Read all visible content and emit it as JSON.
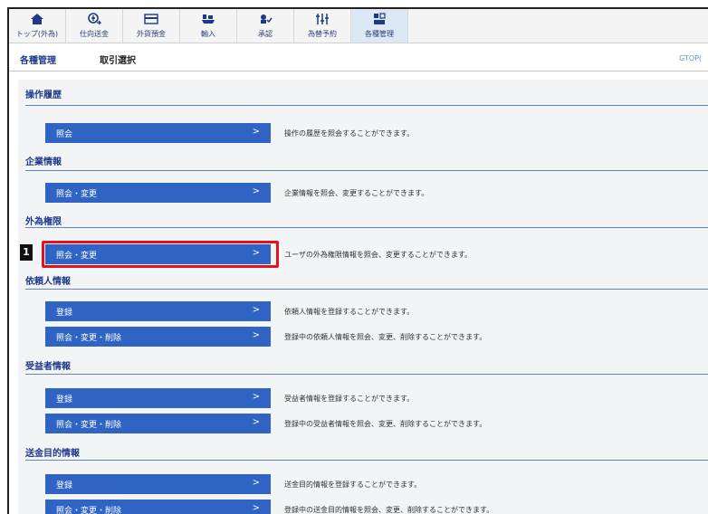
{
  "nav": {
    "tabs": [
      {
        "label": "トップ(外為)",
        "icon": "home-icon"
      },
      {
        "label": "仕向送金",
        "icon": "money-send-icon"
      },
      {
        "label": "外貨預金",
        "icon": "deposit-card-icon"
      },
      {
        "label": "輸入",
        "icon": "import-ship-icon"
      },
      {
        "label": "承認",
        "icon": "approval-icon"
      },
      {
        "label": "為替予約",
        "icon": "exchange-contract-icon"
      },
      {
        "label": "各種管理",
        "icon": "management-icon"
      }
    ],
    "active_index": 6
  },
  "breadcrumb": {
    "section": "各種管理",
    "page": "取引選択",
    "screen_id": "GTOP("
  },
  "sections": [
    {
      "title": "操作履歴",
      "rows": [
        {
          "button": "照会",
          "desc": "操作の履歴を照会することができます。"
        }
      ]
    },
    {
      "title": "企業情報",
      "rows": [
        {
          "button": "照会・変更",
          "desc": "企業情報を照会、変更することができます。"
        }
      ]
    },
    {
      "title": "外為権限",
      "rows": [
        {
          "button": "照会・変更",
          "desc": "ユーザの外為権限情報を照会、変更することができます。"
        }
      ]
    },
    {
      "title": "依頼人情報",
      "rows": [
        {
          "button": "登録",
          "desc": "依頼人情報を登録することができます。"
        },
        {
          "button": "照会・変更・削除",
          "desc": "登録中の依頼人情報を照会、変更、削除することができます。"
        }
      ]
    },
    {
      "title": "受益者情報",
      "rows": [
        {
          "button": "登録",
          "desc": "受益者情報を登録することができます。"
        },
        {
          "button": "照会・変更・削除",
          "desc": "登録中の受益者情報を照会、変更、削除することができます。"
        }
      ]
    },
    {
      "title": "送金目的情報",
      "rows": [
        {
          "button": "登録",
          "desc": "送金目的情報を登録することができます。"
        },
        {
          "button": "照会・変更・削除",
          "desc": "登録中の送金目的情報を照会、変更、削除することができます。"
        }
      ]
    }
  ],
  "button_arrow": ">",
  "annotation": {
    "step": "1"
  },
  "colors": {
    "button": "#2f63c4",
    "highlight": "#e0141e",
    "accent": "#1d3a8a"
  }
}
